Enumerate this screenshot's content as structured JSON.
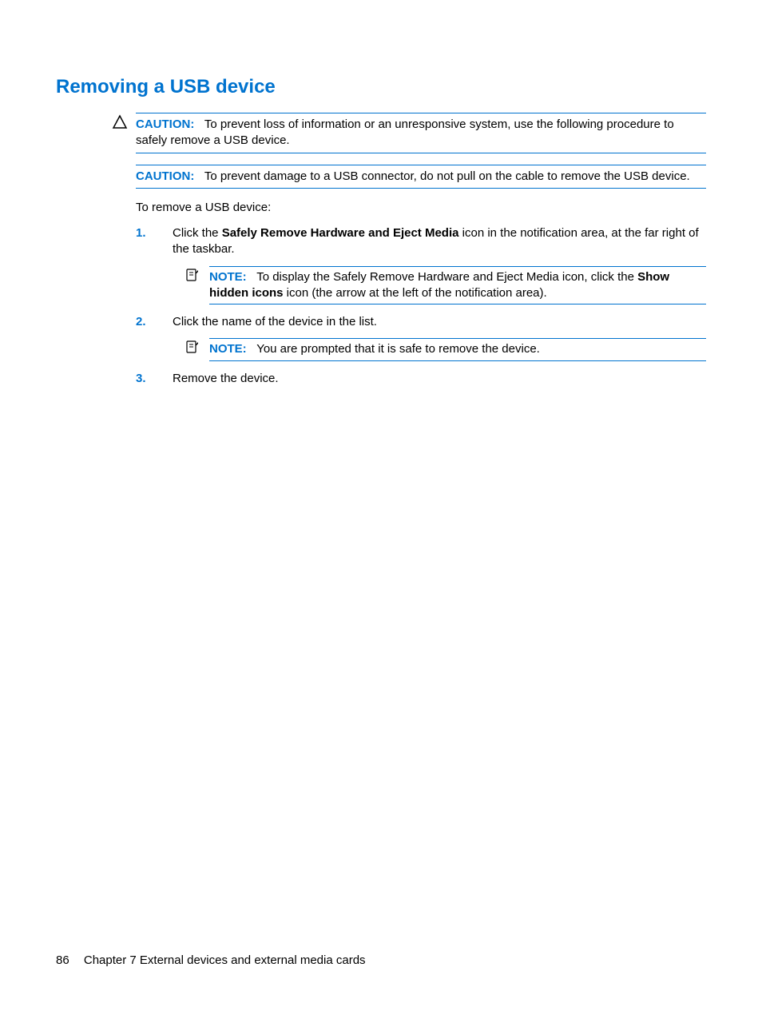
{
  "title": "Removing a USB device",
  "caution1": {
    "label": "CAUTION:",
    "text_before": "To prevent loss of information or an unresponsive system, use the following procedure to safely remove a USB device."
  },
  "caution2": {
    "label": "CAUTION:",
    "text": "To prevent damage to a USB connector, do not pull on the cable to remove the USB device."
  },
  "intro": "To remove a USB device:",
  "steps": {
    "s1": {
      "num": "1.",
      "pre": "Click the ",
      "bold": "Safely Remove Hardware and Eject Media",
      "post": " icon in the notification area, at the far right of the taskbar."
    },
    "s1note": {
      "label": "NOTE:",
      "pre": "To display the Safely Remove Hardware and Eject Media icon, click the ",
      "bold": "Show hidden icons",
      "post": " icon (the arrow at the left of the notification area)."
    },
    "s2": {
      "num": "2.",
      "text": "Click the name of the device in the list."
    },
    "s2note": {
      "label": "NOTE:",
      "text": "You are prompted that it is safe to remove the device."
    },
    "s3": {
      "num": "3.",
      "text": "Remove the device."
    }
  },
  "footer": {
    "page": "86",
    "chapter": "Chapter 7   External devices and external media cards"
  }
}
